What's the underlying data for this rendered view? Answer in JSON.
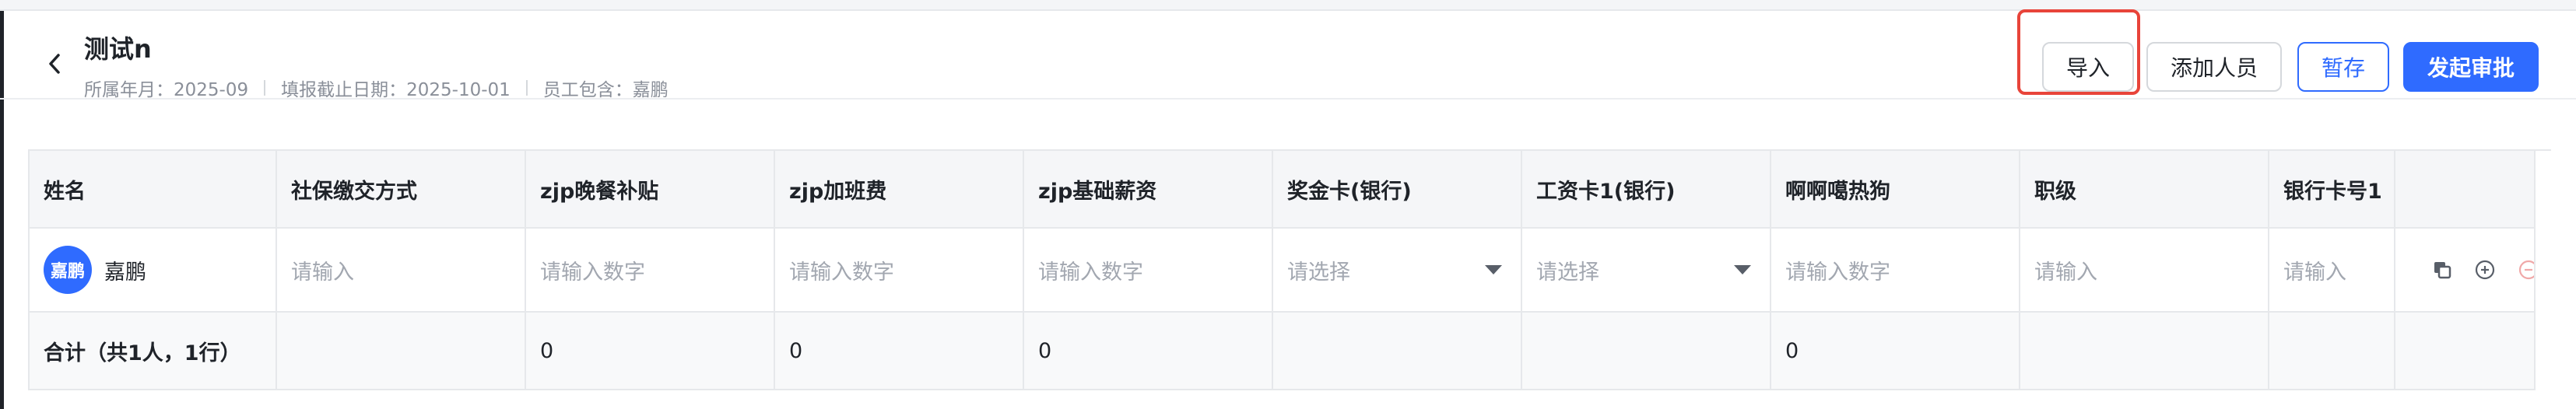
{
  "header": {
    "title": "测试n",
    "meta": {
      "month": "所属年月：2025-09",
      "deadline": "填报截止日期：2025-10-01",
      "employees": "员工包含：嘉鹏"
    },
    "buttons": {
      "import": "导入",
      "add_person": "添加人员",
      "save_draft": "暂存",
      "submit": "发起审批"
    }
  },
  "table": {
    "columns": [
      "姓名",
      "社保缴交方式",
      "zjp晚餐补贴",
      "zjp加班费",
      "zjp基础薪资",
      "奖金卡(银行)",
      "工资卡1(银行)",
      "啊啊噶热狗",
      "职级",
      "银行卡号1"
    ],
    "row": {
      "avatar": "嘉鹏",
      "name": "嘉鹏",
      "cells": [
        "请输入",
        "请输入数字",
        "请输入数字",
        "请输入数字",
        "请选择",
        "请选择",
        "请输入数字",
        "请输入",
        "请输入"
      ]
    },
    "total": {
      "label": "合计（共1人，1行）",
      "cells": [
        "",
        "0",
        "0",
        "0",
        "",
        "",
        "0",
        "",
        ""
      ]
    }
  },
  "icons": {
    "back": "chevron-left-icon",
    "copy": "copy-icon",
    "add": "plus-circle-icon",
    "remove": "minus-circle-icon"
  },
  "colors": {
    "primary": "#2f6bff",
    "highlight": "#e8443a",
    "remove": "#f0a8a8"
  }
}
